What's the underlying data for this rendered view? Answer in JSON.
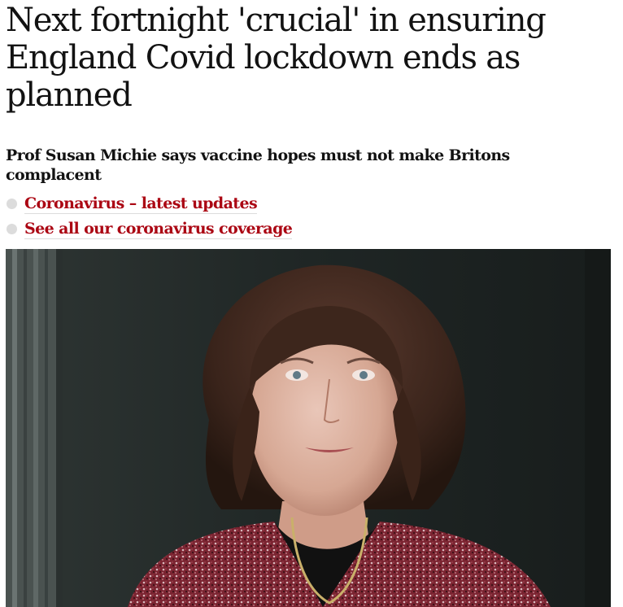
{
  "article": {
    "headline": "Next fortnight 'crucial' in ensuring England Covid lockdown ends as planned",
    "standfirst": "Prof Susan Michie says vaccine hopes must not make Britons complacent",
    "related_links": [
      {
        "label": "Coronavirus – latest updates"
      },
      {
        "label": "See all our coronavirus coverage"
      }
    ]
  },
  "colors": {
    "text": "#121212",
    "link": "#ab0613",
    "bullet": "#dcdcdc",
    "photo_background": "#1d2322"
  }
}
